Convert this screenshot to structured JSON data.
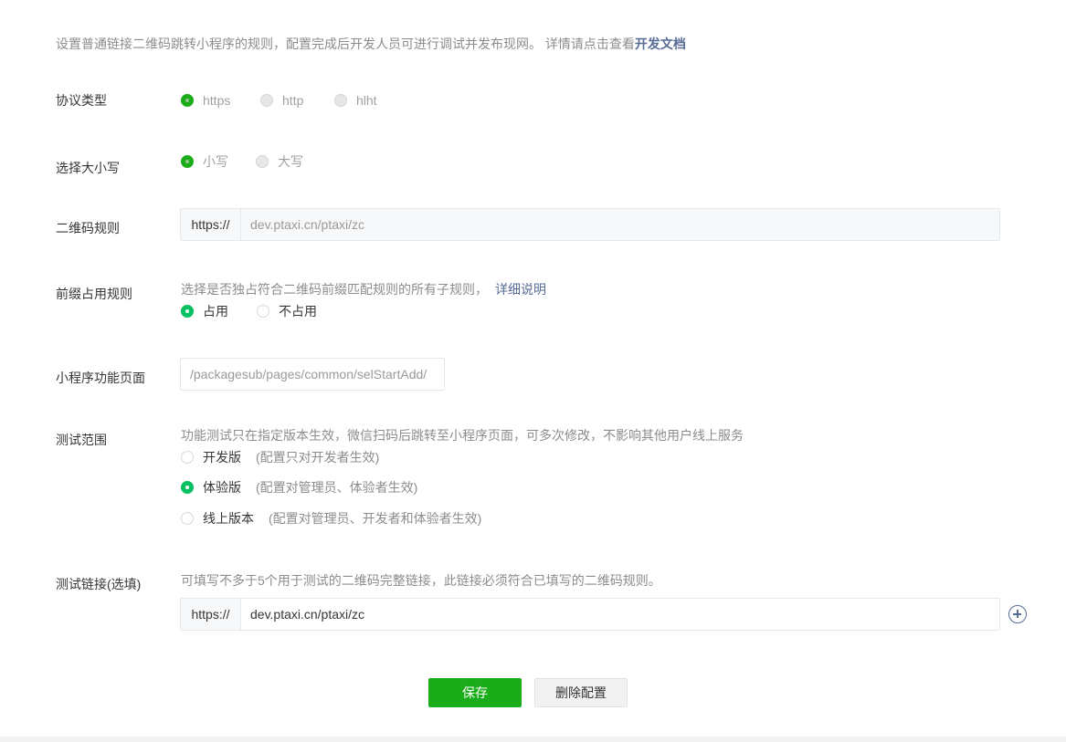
{
  "intro": {
    "text": "设置普通链接二维码跳转小程序的规则，配置完成后开发人员可进行调试并发布现网。 详情请点击查看",
    "link": "开发文档"
  },
  "protocol": {
    "label": "协议类型",
    "options": [
      {
        "label": "https",
        "selected": true
      },
      {
        "label": "http",
        "selected": false
      },
      {
        "label": "hlht",
        "selected": false
      }
    ]
  },
  "case": {
    "label": "选择大小写",
    "options": [
      {
        "label": "小写",
        "selected": true
      },
      {
        "label": "大写",
        "selected": false
      }
    ]
  },
  "qr_rule": {
    "label": "二维码规则",
    "prefix": "https://",
    "value": "dev.ptaxi.cn/ptaxi/zc"
  },
  "prefix_rule": {
    "label": "前缀占用规则",
    "desc": "选择是否独占符合二维码前缀匹配规则的所有子规则，",
    "link": "详细说明",
    "options": [
      {
        "label": "占用",
        "selected": true
      },
      {
        "label": "不占用",
        "selected": false
      }
    ]
  },
  "page_path": {
    "label": "小程序功能页面",
    "value": "/packagesub/pages/common/selStartAdd/"
  },
  "test_scope": {
    "label": "测试范围",
    "desc": "功能测试只在指定版本生效，微信扫码后跳转至小程序页面，可多次修改，不影响其他用户线上服务",
    "options": [
      {
        "label": "开发版",
        "note": "(配置只对开发者生效)",
        "selected": false
      },
      {
        "label": "体验版",
        "note": "(配置对管理员、体验者生效)",
        "selected": true
      },
      {
        "label": "线上版本",
        "note": "(配置对管理员、开发者和体验者生效)",
        "selected": false
      }
    ]
  },
  "test_link": {
    "label": "测试链接(选填)",
    "desc": "可填写不多于5个用于测试的二维码完整链接，此链接必须符合已填写的二维码规则。",
    "prefix": "https://",
    "value": "dev.ptaxi.cn/ptaxi/zc"
  },
  "actions": {
    "save": "保存",
    "delete": "删除配置"
  },
  "colors": {
    "primary": "#1aad19",
    "radio_checked": "#07c160",
    "link": "#576b95"
  }
}
